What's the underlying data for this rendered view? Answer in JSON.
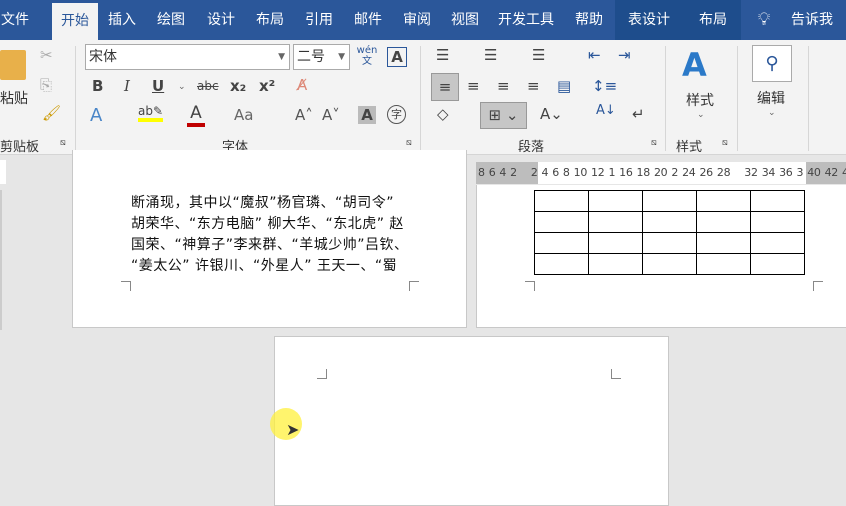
{
  "tabs": [
    "文件",
    "开始",
    "插入",
    "绘图",
    "设计",
    "布局",
    "引用",
    "邮件",
    "审阅",
    "视图",
    "开发工具",
    "帮助",
    "表设计",
    "布局"
  ],
  "tell_me": "告诉我",
  "clipboard": {
    "paste": "粘贴",
    "group": "剪贴板"
  },
  "font": {
    "name": "宋体",
    "size": "二号",
    "group": "字体",
    "bold": "B",
    "italic": "I",
    "underline": "U",
    "strike": "abc",
    "sub": "x₂",
    "sup": "x²",
    "case": "Aa",
    "phonetic": "wén文"
  },
  "paragraph": {
    "group": "段落"
  },
  "styles": {
    "label": "样式",
    "group": "样式"
  },
  "editing": {
    "label": "编辑"
  },
  "ruler": [
    "8",
    "6",
    "4",
    "2",
    "",
    "2",
    "4",
    "6",
    "8",
    "10",
    "12",
    "1",
    "16",
    "18",
    "20",
    "2",
    "24",
    "26",
    "28",
    "",
    "32",
    "34",
    "36",
    "3",
    "40",
    "42",
    "4"
  ],
  "doc_lines": [
    "断涌现，其中以“魔叔”杨官璘、“胡司令”",
    "胡荣华、“东方电脑” 柳大华、“东北虎” 赵",
    "国荣、“神算子”李来群、“羊城少帅”吕钦、",
    " “姜太公” 许银川、“外星人” 王天一、“蜀"
  ],
  "colors": {
    "brand": "#2b579a",
    "highlight": "#ffff00",
    "font_color": "#c00000"
  }
}
